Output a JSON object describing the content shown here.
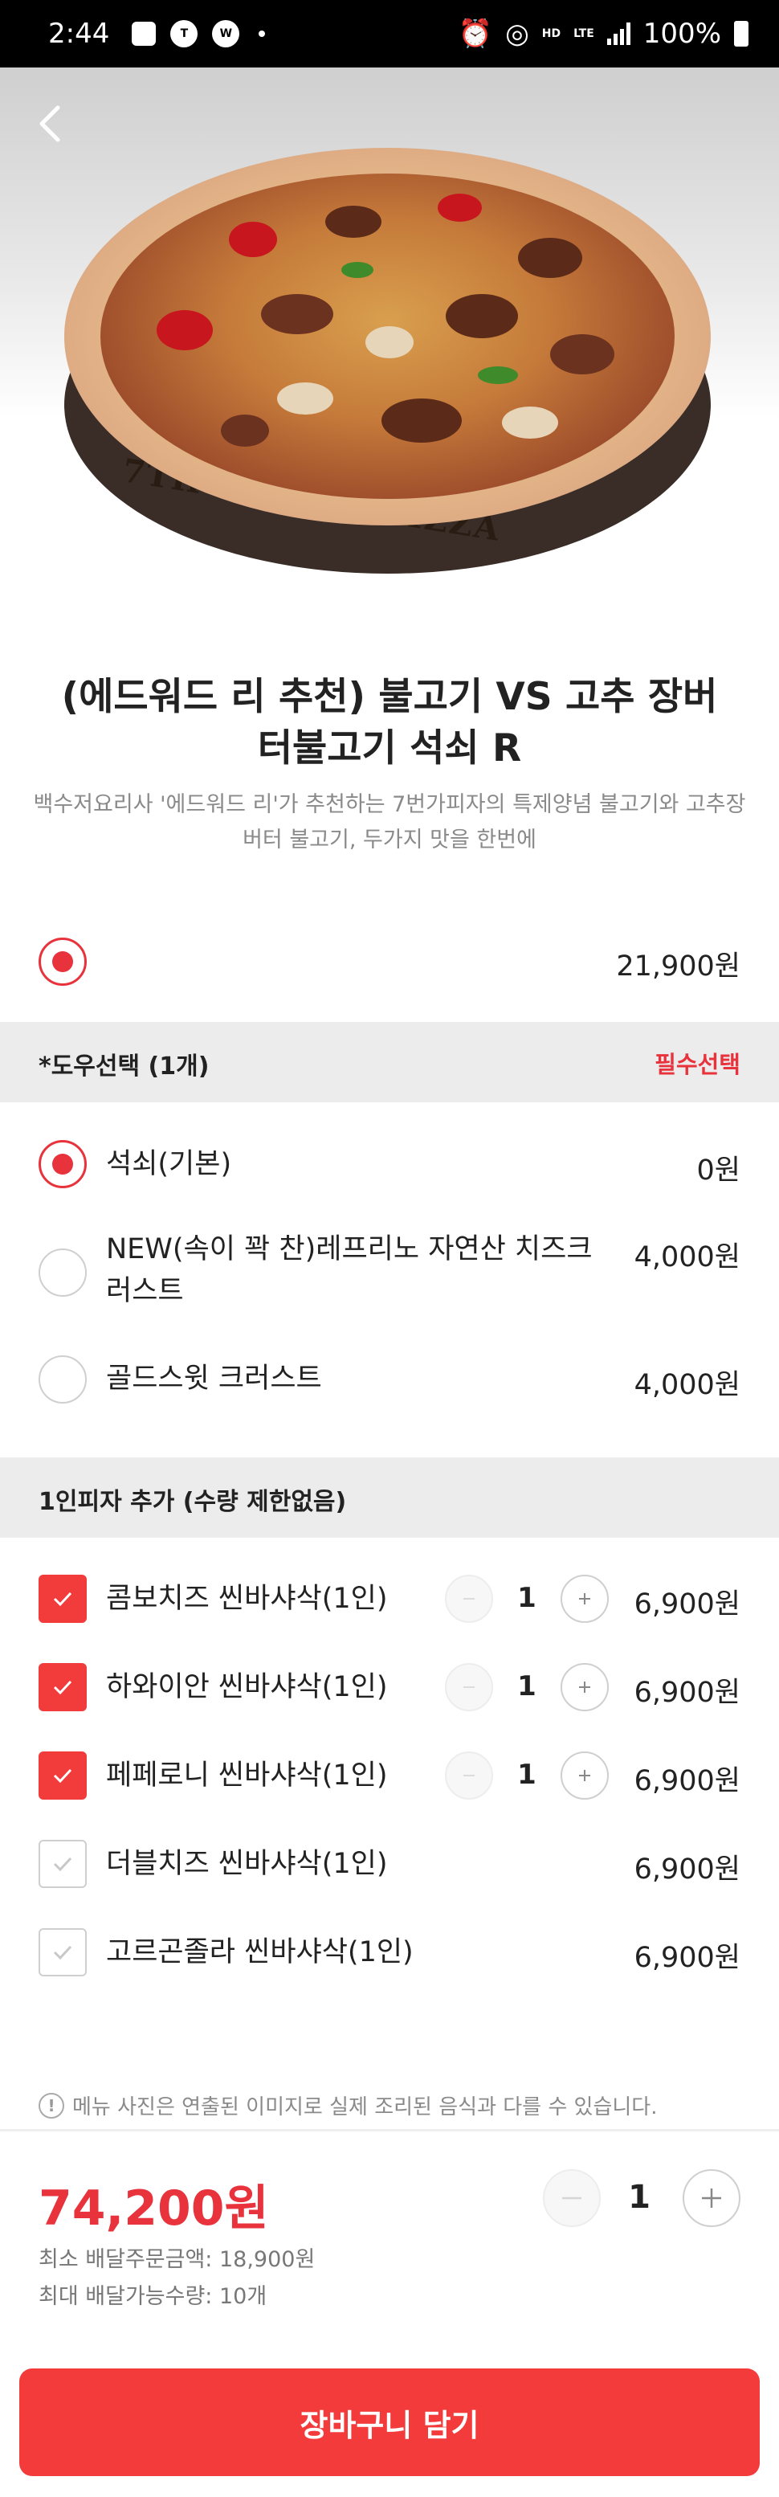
{
  "status_bar": {
    "time": "2:44",
    "battery": "100%",
    "network": "LTE",
    "hd_label": "HD"
  },
  "product": {
    "title": "(에드워드 리 추천) 불고기 VS 고추 장버터불고기 석쇠 R",
    "description": "백수저요리사 '에드워드 리'가 추천하는 7번가피자의 특제양념 불고기와 고추장버터 불고기, 두가지 맛을 한번에",
    "price": "21,900원",
    "plate_text": "7TH STREET PIZZA"
  },
  "dough_section": {
    "title": "*도우선택 (1개)",
    "required_label": "필수선택",
    "options": [
      {
        "label": "석쇠(기본)",
        "price": "0원",
        "selected": true
      },
      {
        "label": "NEW(속이 꽉 찬)레프리노 자연산 치즈크러스트",
        "price": "4,000원",
        "selected": false
      },
      {
        "label": "골드스윗 크러스트",
        "price": "4,000원",
        "selected": false
      }
    ]
  },
  "single_pizza_section": {
    "title": "1인피자 추가 (수량 제한없음)",
    "items": [
      {
        "label": "콤보치즈 씬바샤삭(1인)",
        "price": "6,900원",
        "checked": true,
        "qty": "1"
      },
      {
        "label": "하와이안 씬바샤삭(1인)",
        "price": "6,900원",
        "checked": true,
        "qty": "1"
      },
      {
        "label": "페페로니 씬바샤삭(1인)",
        "price": "6,900원",
        "checked": true,
        "qty": "1"
      },
      {
        "label": "더블치즈 씬바샤삭(1인)",
        "price": "6,900원",
        "checked": false
      },
      {
        "label": "고르곤졸라 씬바샤삭(1인)",
        "price": "6,900원",
        "checked": false
      }
    ]
  },
  "notice": "메뉴 사진은 연출된 이미지로 실제 조리된 음식과 다를 수 있습니다.",
  "summary": {
    "total": "74,200원",
    "min_order": "최소 배달주문금액: 18,900원",
    "max_qty": "최대 배달가능수량: 10개",
    "qty": "1"
  },
  "cart_button": "장바구니 담기",
  "colors": {
    "accent": "#e8323c",
    "button": "#f33b3b",
    "band": "#ececec"
  }
}
